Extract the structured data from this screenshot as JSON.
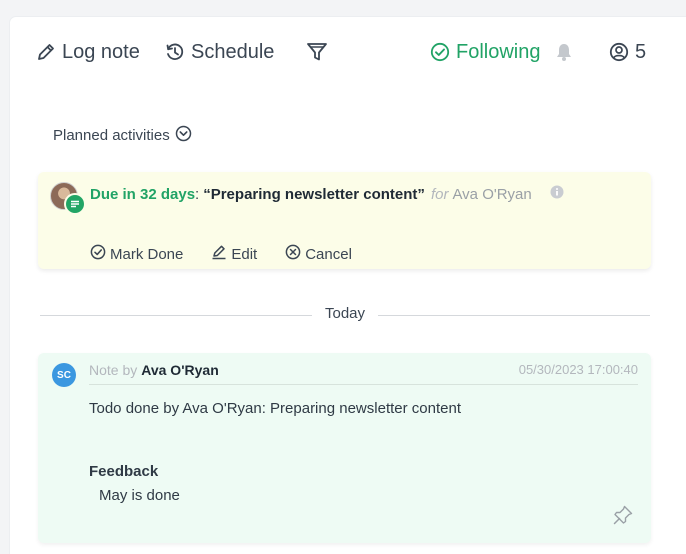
{
  "toolbar": {
    "log_note_label": "Log note",
    "schedule_label": "Schedule",
    "following_label": "Following",
    "followers_count": "5"
  },
  "planned": {
    "label": "Planned activities"
  },
  "activity": {
    "due_label": "Due in 32 days",
    "separator": ":",
    "summary": "“Preparing newsletter content”",
    "for_word": "for",
    "assignee": "Ava O'Ryan",
    "actions": {
      "mark_done": "Mark Done",
      "edit": "Edit",
      "cancel": "Cancel"
    }
  },
  "separator": {
    "label": "Today"
  },
  "note": {
    "avatar_initials": "SC",
    "type_label": "Note by",
    "author": "Ava O'Ryan",
    "timestamp": "05/30/2023 17:00:40",
    "body": "Todo done by Ava O'Ryan: Preparing newsletter content",
    "feedback_title": "Feedback",
    "feedback_text": "May is done"
  },
  "colors": {
    "accent_green": "#21a366",
    "activity_bg": "#fcfde8",
    "note_bg": "#eefbf4",
    "avatar_blue": "#3b97e0"
  },
  "icons": {
    "log_note": "pencil-icon",
    "schedule": "clock-history-icon",
    "filter": "funnel-icon",
    "following": "check-circle-icon",
    "bell": "bell-icon",
    "followers": "user-circle-icon",
    "planned_toggle": "chevron-down-circle-icon",
    "activity_type": "note-lines-icon",
    "info": "info-circle-icon",
    "mark_done": "check-circle-icon",
    "edit": "pencil-square-icon",
    "cancel": "x-circle-icon",
    "pin": "pin-icon"
  }
}
